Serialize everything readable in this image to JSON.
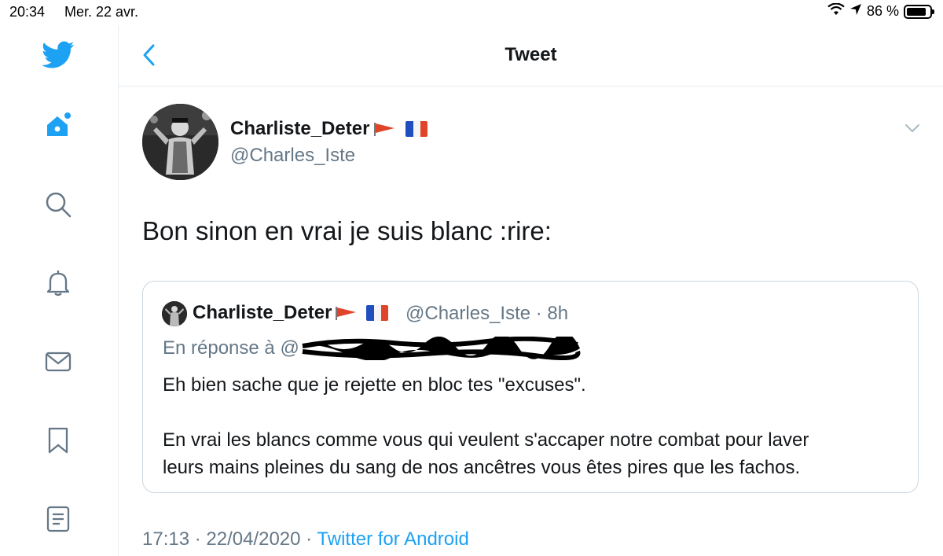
{
  "status_bar": {
    "time": "20:34",
    "date": "Mer. 22 avr.",
    "battery": "86 %",
    "battery_level": 0.86
  },
  "sidebar": {
    "icons": [
      "twitter-bird-icon",
      "home-icon",
      "search-icon",
      "notifications-icon",
      "messages-icon",
      "bookmarks-icon",
      "lists-icon"
    ]
  },
  "header": {
    "title": "Tweet"
  },
  "tweet": {
    "display_name": "Charliste_Deter",
    "handle": "@Charles_Iste",
    "text": "Bon sinon en vrai je suis blanc :rire:",
    "timestamp": "17:13 · 22/04/2020 · ",
    "source": "Twitter for Android"
  },
  "quote": {
    "display_name": "Charliste_Deter",
    "handle_time": "@Charles_Iste · 8h",
    "reply_prefix": "En réponse à @",
    "line1": "Eh bien sache que je rejette en bloc tes \"excuses\".",
    "line2": "En vrai les blancs comme vous qui veulent s'accaper notre combat pour laver",
    "line3": "leurs mains pleines du sang de nos ancêtres vous êtes pires que les fachos."
  },
  "colors": {
    "accent": "#1da1f2",
    "text": "#14171a",
    "secondary": "#657786",
    "border": "#ccd6dd",
    "flag_red": "#e0452a",
    "flag_blue": "#1f4fbf"
  }
}
